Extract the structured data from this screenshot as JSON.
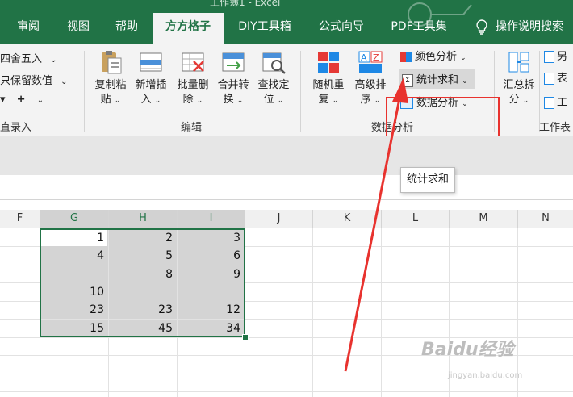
{
  "title_partial": "工作簿1 - Excel",
  "tabs": [
    "审阅",
    "视图",
    "帮助",
    "方方格子",
    "DIY工具箱",
    "公式向导",
    "PDF工具集"
  ],
  "active_tab": "方方格子",
  "tell_me": "操作说明搜索",
  "left_group": {
    "round": "四舍五入",
    "keep_value": "只保留数值",
    "label": "直录入"
  },
  "edit_buttons": [
    {
      "l1": "复制粘",
      "l2": "贴"
    },
    {
      "l1": "新增插",
      "l2": "入"
    },
    {
      "l1": "批量删",
      "l2": "除"
    },
    {
      "l1": "合并转",
      "l2": "换"
    },
    {
      "l1": "查找定",
      "l2": "位"
    }
  ],
  "edit_group_label": "编辑",
  "data_buttons": [
    {
      "l1": "随机重",
      "l2": "复"
    },
    {
      "l1": "高级排",
      "l2": "序"
    }
  ],
  "data_small": {
    "color_analysis": "颜色分析",
    "stat_sum": "统计求和",
    "data_analysis": "数据分析"
  },
  "data_group_label": "数据分析",
  "summary_btn": {
    "l1": "汇总拆",
    "l2": "分"
  },
  "worksheet_label": "工作表",
  "right_partial": [
    "另",
    "表",
    "工"
  ],
  "tooltip": "统计求和",
  "columns": [
    "F",
    "G",
    "H",
    "I",
    "J",
    "K",
    "L",
    "M",
    "N"
  ],
  "grid": [
    [
      "1",
      "2",
      "3"
    ],
    [
      "4",
      "5",
      "6"
    ],
    [
      "",
      "8",
      "9"
    ],
    [
      "10",
      "",
      ""
    ],
    [
      "23",
      "23",
      "12"
    ],
    [
      "15",
      "45",
      "34"
    ]
  ],
  "watermark": "Baidu经验",
  "watermark_sub": "jingyan.baidu.com",
  "colors": {
    "excel_green": "#217346",
    "highlight": "#e8322e",
    "selection": "#d2d2d2"
  }
}
